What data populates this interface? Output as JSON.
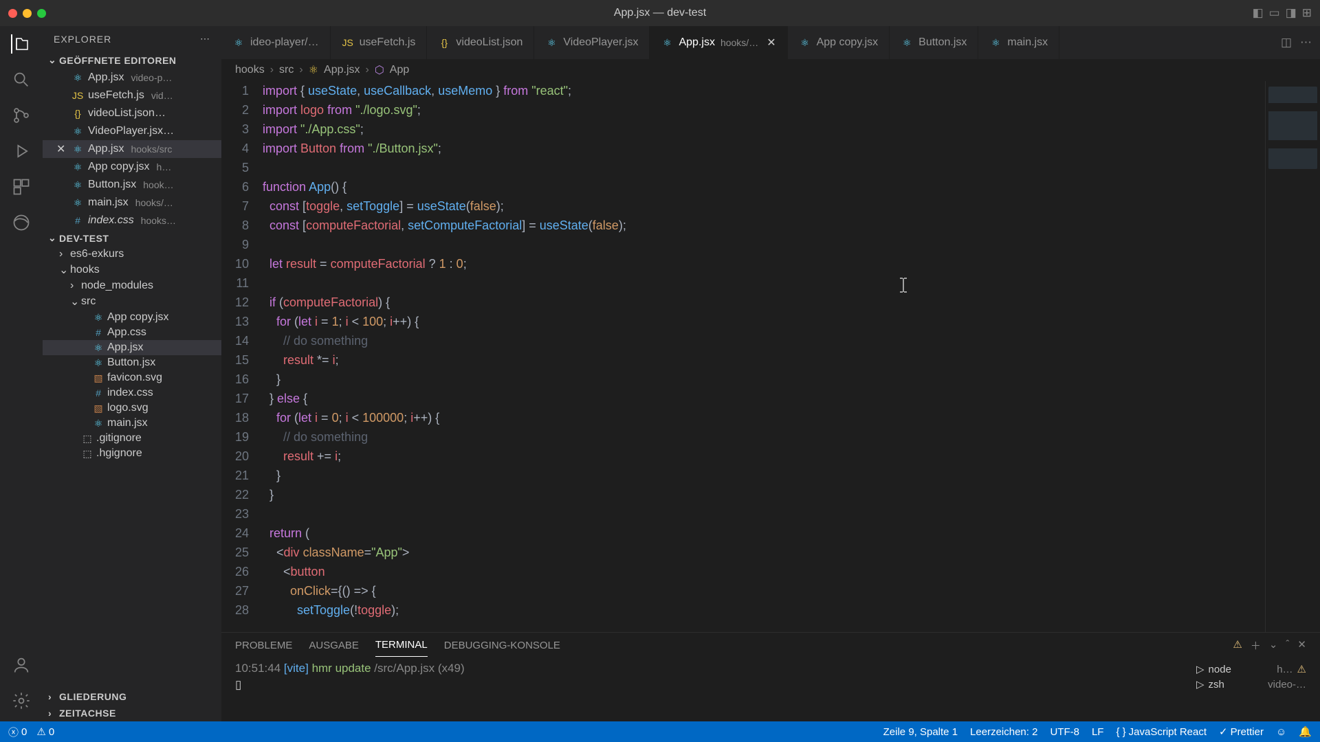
{
  "titlebar": {
    "title": "App.jsx — dev-test"
  },
  "sidebar": {
    "title": "EXPLORER",
    "openEditorsLabel": "GEÖFFNETE EDITOREN",
    "projectLabel": "DEV-TEST",
    "outlineLabel": "GLIEDERUNG",
    "timelineLabel": "ZEITACHSE",
    "openEditors": [
      {
        "name": "App.jsx",
        "meta": "video-p…",
        "icon": "react"
      },
      {
        "name": "useFetch.js",
        "meta": "vid…",
        "icon": "js"
      },
      {
        "name": "videoList.json…",
        "meta": "",
        "icon": "json"
      },
      {
        "name": "VideoPlayer.jsx…",
        "meta": "",
        "icon": "react"
      },
      {
        "name": "App.jsx",
        "meta": "hooks/src",
        "icon": "react",
        "active": true
      },
      {
        "name": "App copy.jsx",
        "meta": "h…",
        "icon": "react"
      },
      {
        "name": "Button.jsx",
        "meta": "hook…",
        "icon": "react"
      },
      {
        "name": "main.jsx",
        "meta": "hooks/…",
        "icon": "react"
      },
      {
        "name": "index.css",
        "meta": "hooks…",
        "icon": "css",
        "italic": true
      }
    ],
    "tree": [
      {
        "label": "es6-exkurs",
        "indent": 1,
        "chev": "›"
      },
      {
        "label": "hooks",
        "indent": 1,
        "chev": "⌄"
      },
      {
        "label": "node_modules",
        "indent": 2,
        "chev": "›"
      },
      {
        "label": "src",
        "indent": 2,
        "chev": "⌄"
      },
      {
        "label": "App copy.jsx",
        "indent": 3,
        "icon": "react"
      },
      {
        "label": "App.css",
        "indent": 3,
        "icon": "css"
      },
      {
        "label": "App.jsx",
        "indent": 3,
        "icon": "react",
        "active": true
      },
      {
        "label": "Button.jsx",
        "indent": 3,
        "icon": "react"
      },
      {
        "label": "favicon.svg",
        "indent": 3,
        "icon": "svg"
      },
      {
        "label": "index.css",
        "indent": 3,
        "icon": "css"
      },
      {
        "label": "logo.svg",
        "indent": 3,
        "icon": "svg"
      },
      {
        "label": "main.jsx",
        "indent": 3,
        "icon": "react"
      },
      {
        "label": ".gitignore",
        "indent": 2,
        "icon": "file"
      },
      {
        "label": ".hgignore",
        "indent": 2,
        "icon": "file"
      }
    ]
  },
  "tabs": [
    {
      "label": "ideo-player/…",
      "icon": "react"
    },
    {
      "label": "useFetch.js",
      "icon": "js"
    },
    {
      "label": "videoList.json",
      "icon": "json"
    },
    {
      "label": "VideoPlayer.jsx",
      "icon": "react"
    },
    {
      "label": "App.jsx",
      "meta": "hooks/…",
      "icon": "react",
      "active": true
    },
    {
      "label": "App copy.jsx",
      "icon": "react"
    },
    {
      "label": "Button.jsx",
      "icon": "react"
    },
    {
      "label": "main.jsx",
      "icon": "react"
    }
  ],
  "breadcrumbs": {
    "parts": [
      "hooks",
      "src",
      "App.jsx",
      "App"
    ]
  },
  "code": {
    "lines": [
      [
        [
          "import",
          "import "
        ],
        [
          "punct",
          "{ "
        ],
        [
          "func",
          "useState"
        ],
        [
          "punct",
          ", "
        ],
        [
          "func",
          "useCallback"
        ],
        [
          "punct",
          ", "
        ],
        [
          "func",
          "useMemo"
        ],
        [
          "punct",
          " } "
        ],
        [
          "import",
          "from "
        ],
        [
          "string",
          "\"react\""
        ],
        [
          "punct",
          ";"
        ]
      ],
      [
        [
          "import",
          "import "
        ],
        [
          "var",
          "logo"
        ],
        [
          "default",
          " "
        ],
        [
          "import",
          "from "
        ],
        [
          "string",
          "\"./logo.svg\""
        ],
        [
          "punct",
          ";"
        ]
      ],
      [
        [
          "import",
          "import "
        ],
        [
          "string",
          "\"./App.css\""
        ],
        [
          "punct",
          ";"
        ]
      ],
      [
        [
          "import",
          "import "
        ],
        [
          "var",
          "Button"
        ],
        [
          "default",
          " "
        ],
        [
          "import",
          "from "
        ],
        [
          "string",
          "\"./Button.jsx\""
        ],
        [
          "punct",
          ";"
        ]
      ],
      [],
      [
        [
          "keyword",
          "function "
        ],
        [
          "func",
          "App"
        ],
        [
          "punct",
          "() {"
        ]
      ],
      [
        [
          "default",
          "  "
        ],
        [
          "keyword",
          "const "
        ],
        [
          "punct",
          "["
        ],
        [
          "var",
          "toggle"
        ],
        [
          "punct",
          ", "
        ],
        [
          "func",
          "setToggle"
        ],
        [
          "punct",
          "] = "
        ],
        [
          "func",
          "useState"
        ],
        [
          "punct",
          "("
        ],
        [
          "const",
          "false"
        ],
        [
          "punct",
          ");"
        ]
      ],
      [
        [
          "default",
          "  "
        ],
        [
          "keyword",
          "const "
        ],
        [
          "punct",
          "["
        ],
        [
          "var",
          "computeFactorial"
        ],
        [
          "punct",
          ", "
        ],
        [
          "func",
          "setComputeFactorial"
        ],
        [
          "punct",
          "] = "
        ],
        [
          "func",
          "useState"
        ],
        [
          "punct",
          "("
        ],
        [
          "const",
          "false"
        ],
        [
          "punct",
          ");"
        ]
      ],
      [],
      [
        [
          "default",
          "  "
        ],
        [
          "keyword",
          "let "
        ],
        [
          "var",
          "result"
        ],
        [
          "default",
          " = "
        ],
        [
          "var",
          "computeFactorial"
        ],
        [
          "default",
          " ? "
        ],
        [
          "number",
          "1"
        ],
        [
          "default",
          " : "
        ],
        [
          "number",
          "0"
        ],
        [
          "punct",
          ";"
        ]
      ],
      [],
      [
        [
          "default",
          "  "
        ],
        [
          "keyword",
          "if "
        ],
        [
          "punct",
          "("
        ],
        [
          "var",
          "computeFactorial"
        ],
        [
          "punct",
          ") {"
        ]
      ],
      [
        [
          "default",
          "    "
        ],
        [
          "keyword",
          "for "
        ],
        [
          "punct",
          "("
        ],
        [
          "keyword",
          "let "
        ],
        [
          "var",
          "i"
        ],
        [
          "default",
          " = "
        ],
        [
          "number",
          "1"
        ],
        [
          "punct",
          "; "
        ],
        [
          "var",
          "i"
        ],
        [
          "default",
          " < "
        ],
        [
          "number",
          "100"
        ],
        [
          "punct",
          "; "
        ],
        [
          "var",
          "i"
        ],
        [
          "punct",
          "++) {"
        ]
      ],
      [
        [
          "default",
          "      "
        ],
        [
          "comment",
          "// do something"
        ]
      ],
      [
        [
          "default",
          "      "
        ],
        [
          "var",
          "result"
        ],
        [
          "default",
          " *= "
        ],
        [
          "var",
          "i"
        ],
        [
          "punct",
          ";"
        ]
      ],
      [
        [
          "default",
          "    "
        ],
        [
          "punct",
          "}"
        ]
      ],
      [
        [
          "default",
          "  "
        ],
        [
          "punct",
          "} "
        ],
        [
          "keyword",
          "else"
        ],
        [
          "punct",
          " {"
        ]
      ],
      [
        [
          "default",
          "    "
        ],
        [
          "keyword",
          "for "
        ],
        [
          "punct",
          "("
        ],
        [
          "keyword",
          "let "
        ],
        [
          "var",
          "i"
        ],
        [
          "default",
          " = "
        ],
        [
          "number",
          "0"
        ],
        [
          "punct",
          "; "
        ],
        [
          "var",
          "i"
        ],
        [
          "default",
          " < "
        ],
        [
          "number",
          "100000"
        ],
        [
          "punct",
          "; "
        ],
        [
          "var",
          "i"
        ],
        [
          "punct",
          "++) {"
        ]
      ],
      [
        [
          "default",
          "      "
        ],
        [
          "comment",
          "// do something"
        ]
      ],
      [
        [
          "default",
          "      "
        ],
        [
          "var",
          "result"
        ],
        [
          "default",
          " += "
        ],
        [
          "var",
          "i"
        ],
        [
          "punct",
          ";"
        ]
      ],
      [
        [
          "default",
          "    "
        ],
        [
          "punct",
          "}"
        ]
      ],
      [
        [
          "default",
          "  "
        ],
        [
          "punct",
          "}"
        ]
      ],
      [],
      [
        [
          "default",
          "  "
        ],
        [
          "keyword",
          "return "
        ],
        [
          "punct",
          "("
        ]
      ],
      [
        [
          "default",
          "    "
        ],
        [
          "punct",
          "<"
        ],
        [
          "tag",
          "div"
        ],
        [
          "default",
          " "
        ],
        [
          "attr",
          "className"
        ],
        [
          "punct",
          "="
        ],
        [
          "string",
          "\"App\""
        ],
        [
          "punct",
          ">"
        ]
      ],
      [
        [
          "default",
          "      "
        ],
        [
          "punct",
          "<"
        ],
        [
          "tag",
          "button"
        ]
      ],
      [
        [
          "default",
          "        "
        ],
        [
          "attr",
          "onClick"
        ],
        [
          "punct",
          "={"
        ],
        [
          "punct",
          "() => {"
        ]
      ],
      [
        [
          "default",
          "          "
        ],
        [
          "func",
          "setToggle"
        ],
        [
          "punct",
          "(!"
        ],
        [
          "var",
          "toggle"
        ],
        [
          "punct",
          ");"
        ]
      ]
    ],
    "startLine": 1
  },
  "panel": {
    "tabs": [
      "PROBLEME",
      "AUSGABE",
      "TERMINAL",
      "DEBUGGING-KONSOLE"
    ],
    "activeTab": 2,
    "terminal": {
      "time": "10:51:44",
      "vite": "[vite]",
      "hmr": "hmr update",
      "path": "/src/App.jsx",
      "count": "(x49)"
    },
    "tasks": [
      {
        "icon": "node",
        "label": "node",
        "meta": "h…",
        "warn": true
      },
      {
        "icon": "zsh",
        "label": "zsh",
        "meta": "video-…"
      }
    ]
  },
  "statusbar": {
    "errors": "0",
    "warnings": "0",
    "position": "Zeile 9, Spalte 1",
    "indent": "Leerzeichen: 2",
    "encoding": "UTF-8",
    "eol": "LF",
    "lang": "JavaScript React",
    "prettier": "Prettier"
  }
}
